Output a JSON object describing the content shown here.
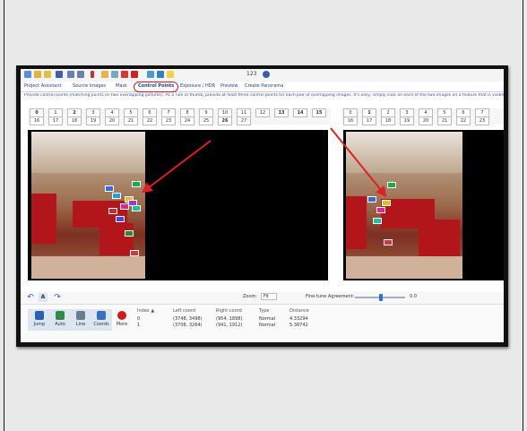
{
  "colors": {
    "accent": "#d21c1c",
    "link": "#2b3a8a",
    "panel": "#dce6f3"
  },
  "toolbar": {
    "zoom_readout": "123"
  },
  "tabs": {
    "items": [
      "Project Assistant",
      "Source Images",
      "Mask",
      "Control Points",
      "Exposure / HDR",
      "Preview",
      "Create Panorama"
    ],
    "active": "Control Points"
  },
  "instruction": "Provide control points (matching points on two overlapping pictures). As a rule of thumb, provide at least three control points for each pair of overlapping images. It's easy: simply click on each of the two images on a feature that is visible in both.",
  "left_images": {
    "row1": [
      "0",
      "1",
      "2",
      "3",
      "4",
      "5",
      "6",
      "7",
      "8",
      "9",
      "10",
      "11",
      "12",
      "13",
      "14",
      "15"
    ],
    "row2": [
      "16",
      "17",
      "18",
      "19",
      "20",
      "21",
      "22",
      "23",
      "24",
      "25",
      "26",
      "27"
    ],
    "bold": [
      "0",
      "2",
      "13",
      "14",
      "15",
      "26"
    ]
  },
  "right_images": {
    "row1": [
      "0",
      "1",
      "2",
      "3",
      "4",
      "5",
      "6",
      "7"
    ],
    "row2": [
      "16",
      "17",
      "18",
      "19",
      "20",
      "21",
      "22",
      "23"
    ],
    "bold": [
      "1"
    ]
  },
  "controls": {
    "zoom_label": "Zoom:",
    "zoom_value": "Fit",
    "fine_tune_label": "Fine-tune Agreement:",
    "fine_tune_value": "0.0"
  },
  "tools": [
    {
      "name": "Jump",
      "icon": "jump-icon"
    },
    {
      "name": "Auto",
      "icon": "auto-icon"
    },
    {
      "name": "Line",
      "icon": "line-icon"
    },
    {
      "name": "Coords",
      "icon": "coords-icon"
    }
  ],
  "more_label": "More",
  "table": {
    "headers": [
      "Index ▲",
      "Left coord",
      "Right coord",
      "Type",
      "Distance"
    ],
    "rows": [
      [
        "0",
        "(3748, 3498)",
        "(954, 1898)",
        "Normal",
        "4.33294"
      ],
      [
        "1",
        "(3708, 3264)",
        "(941, 1912)",
        "Normal",
        "5.38742"
      ]
    ]
  }
}
